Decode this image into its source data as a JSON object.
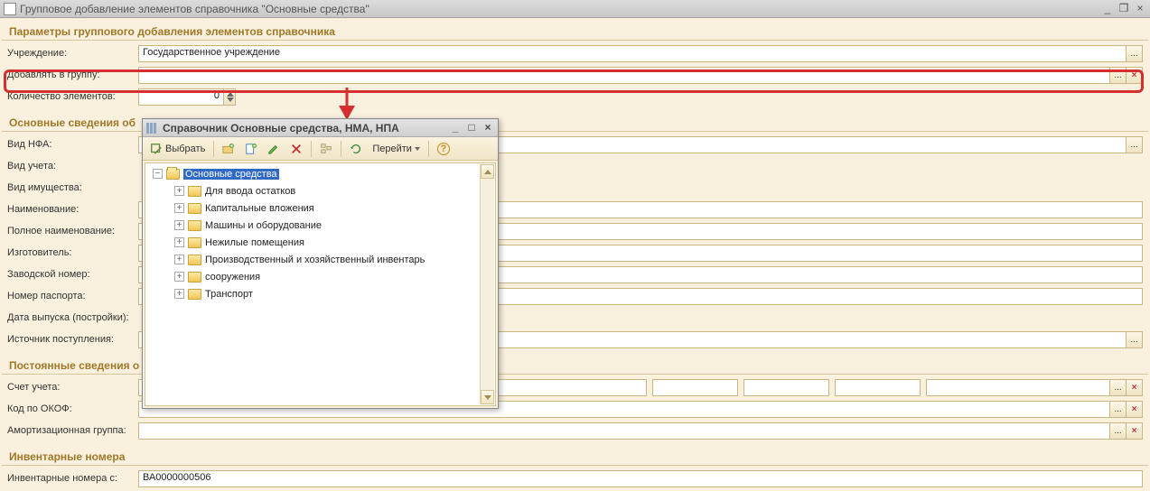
{
  "window": {
    "title": "Групповое добавление элементов справочника \"Основные средства\"",
    "min_label": "_",
    "restore_label": "❐",
    "close_label": "×"
  },
  "sections": {
    "params": "Параметры группового добавления элементов справочника",
    "basic": "Основные сведения об",
    "perm": "Постоянные сведения о",
    "inv": "Инвентарные номера"
  },
  "labels": {
    "org": "Учреждение:",
    "group": "Добавлять в группу:",
    "count": "Количество элементов:",
    "nfa": "Вид НФА:",
    "accounting": "Вид учета:",
    "property": "Вид имущества:",
    "name": "Наименование:",
    "fullname": "Полное наименование:",
    "manuf": "Изготовитель:",
    "factory": "Заводской номер:",
    "passport": "Номер паспорта:",
    "date": "Дата выпуска (постройки):",
    "source": "Источник поступления:",
    "account": "Счет учета:",
    "okof": "Код по ОКОФ:",
    "amort": "Амортизационная группа:",
    "inv_from": "Инвентарные номера с:"
  },
  "values": {
    "org": "Государственное учреждение",
    "group": "",
    "count": "0",
    "inv_from": "ВА0000000506"
  },
  "btn": {
    "dots": "...",
    "x": "×"
  },
  "popup": {
    "title": "Справочник Основные средства, НМА, НПА",
    "select": "Выбрать",
    "goto": "Перейти",
    "help": "?",
    "tree_root": "Основные средства",
    "tree_items": [
      "Для ввода остатков",
      "Капитальные вложения",
      "Машины и оборудование",
      "Нежилые помещения",
      "Производственный и хозяйственный инвентарь",
      "сооружения",
      "Транспорт"
    ]
  }
}
